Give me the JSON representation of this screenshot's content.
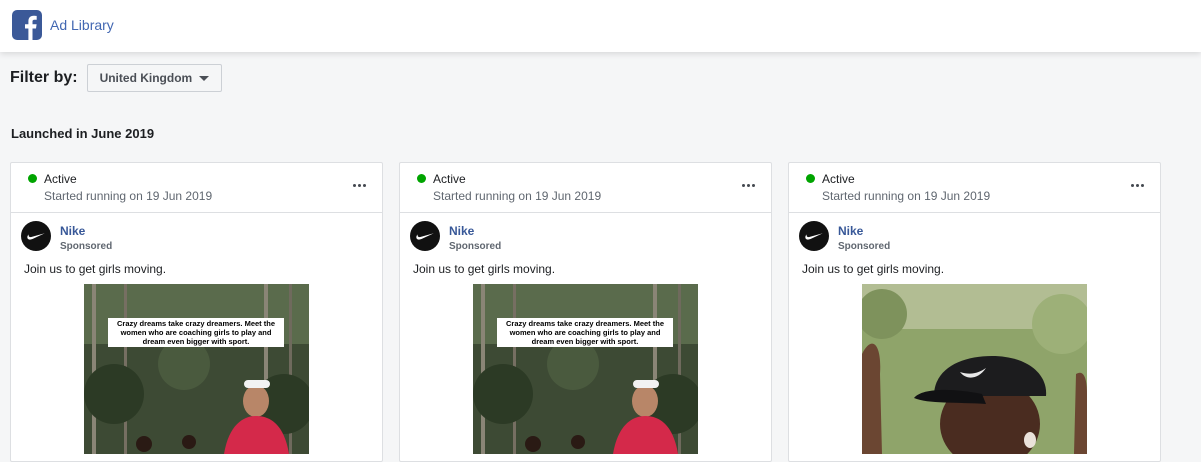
{
  "header": {
    "app_title": "Ad Library",
    "logo_icon": "facebook-logo-icon",
    "brand_color": "#3b5998"
  },
  "filter": {
    "label": "Filter by:",
    "country": "United Kingdom"
  },
  "section": {
    "title": "Launched in June 2019"
  },
  "ads": [
    {
      "status": "Active",
      "status_color": "#00a400",
      "started": "Started running on 19 Jun 2019",
      "advertiser": "Nike",
      "sponsored": "Sponsored",
      "body": "Join us to get girls moving.",
      "image_caption": "Crazy dreams take crazy dreamers. Meet the women who are coaching girls to play and dream even bigger with sport.",
      "image": "runner-in-forest"
    },
    {
      "status": "Active",
      "status_color": "#00a400",
      "started": "Started running on 19 Jun 2019",
      "advertiser": "Nike",
      "sponsored": "Sponsored",
      "body": "Join us to get girls moving.",
      "image_caption": "Crazy dreams take crazy dreamers. Meet the women who are coaching girls to play and dream even bigger with sport.",
      "image": "runner-in-forest"
    },
    {
      "status": "Active",
      "status_color": "#00a400",
      "started": "Started running on 19 Jun 2019",
      "advertiser": "Nike",
      "sponsored": "Sponsored",
      "body": "Join us to get girls moving.",
      "image": "woman-in-black-cap"
    }
  ]
}
